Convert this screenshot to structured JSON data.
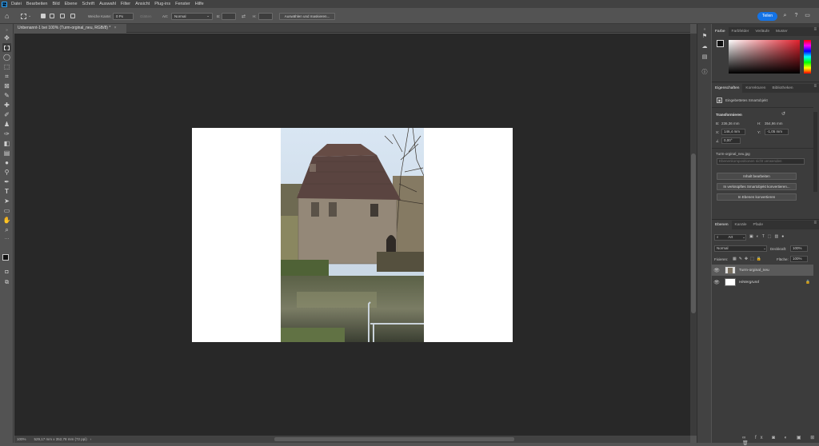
{
  "menubar": {
    "logo": "Ps",
    "items": [
      "Datei",
      "Bearbeiten",
      "Bild",
      "Ebene",
      "Schrift",
      "Auswahl",
      "Filter",
      "Ansicht",
      "Plug-ins",
      "Fenster",
      "Hilfe"
    ]
  },
  "options": {
    "soft_edge_label": "Weiche Kante:",
    "soft_edge_value": "0 Px",
    "smooth_label": "Glätten",
    "style_label": "Art:",
    "style_value": "Normal",
    "width_label": "B:",
    "height_label": "H:",
    "select_mask_label": "Auswählen und maskieren..."
  },
  "share": {
    "label": "Teilen"
  },
  "document": {
    "tab_title": "Unbenannt-1 bei 100% (Turm-orginal_neu, RGB/8) *",
    "tab_close": "×"
  },
  "status": {
    "zoom": "100%",
    "size": "529,17 mm x 352,78 mm (72 ppi)"
  },
  "color_panel": {
    "tabs": [
      "Farbe",
      "Farbfelder",
      "Verläufe",
      "Muster"
    ]
  },
  "properties_panel": {
    "tabs": [
      "Eigenschaften",
      "Korrekturen",
      "Bibliotheken"
    ],
    "type": "Eingebettetes Smartobjekt",
    "transform_label": "Transformieren",
    "w_label": "B:",
    "w_value": "236,36 mm",
    "h_label": "H:",
    "h_value": "354,96 mm",
    "x_label": "X:",
    "x_value": "146,4 mm",
    "y_label": "Y:",
    "y_value": "-1,05 mm",
    "angle_value": "0,00°",
    "filename": "Turm-orginal_neu.jpg",
    "placeholder": "Ebenenkompositionen nicht verwenden",
    "btn1": "Inhalt bearbeiten",
    "btn2": "In verknüpftes Smartobjekt konvertieren...",
    "btn3": "In Ebenen konvertieren"
  },
  "layers_panel": {
    "tabs": [
      "Ebenen",
      "Kanäle",
      "Pfade"
    ],
    "filter_value": "Art",
    "blend_value": "Normal",
    "opacity_label": "Deckkraft:",
    "opacity_value": "100%",
    "lock_label": "Fixieren:",
    "fill_label": "Fläche:",
    "fill_value": "100%",
    "layers": [
      {
        "name": "Turm-orginal_neu"
      },
      {
        "name": "Hintergrund"
      }
    ]
  },
  "colors": {
    "accent": "#1473e6",
    "canvas_bg": "#282828",
    "panel_bg": "#3c3c3c"
  }
}
